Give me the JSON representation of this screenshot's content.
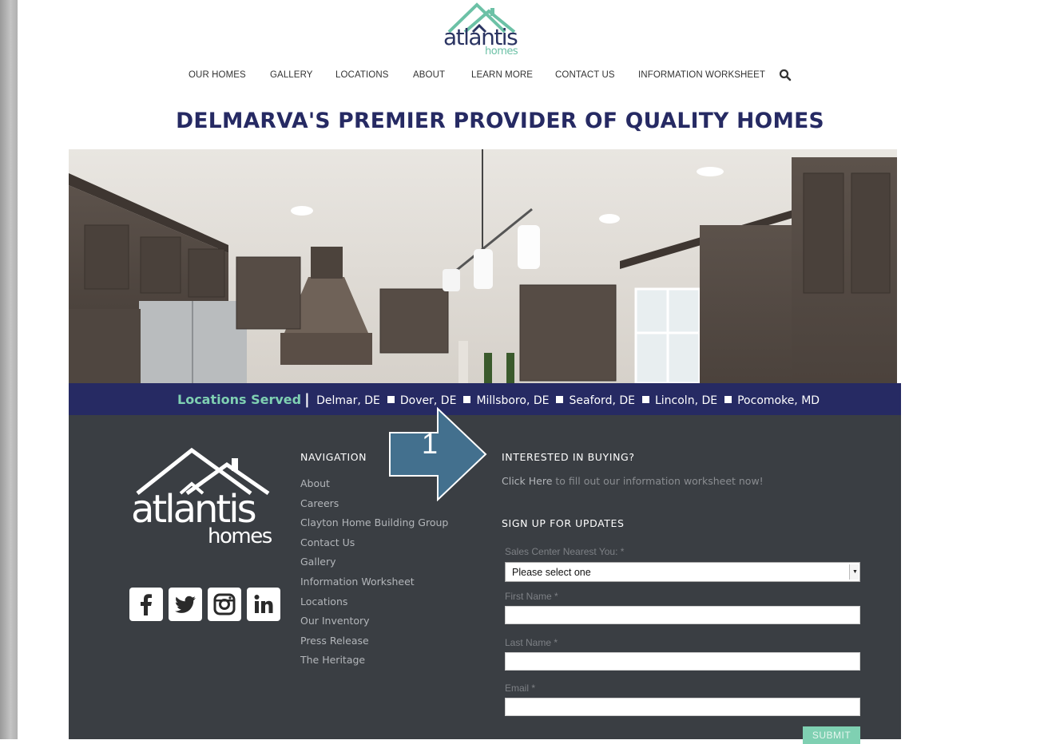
{
  "site": {
    "logo_word": "atlantis",
    "logo_sub": "homes"
  },
  "nav": {
    "items": [
      {
        "label": "OUR HOMES"
      },
      {
        "label": "GALLERY"
      },
      {
        "label": "LOCATIONS"
      },
      {
        "label": "ABOUT"
      },
      {
        "label": "LEARN MORE"
      },
      {
        "label": "CONTACT US"
      },
      {
        "label": "INFORMATION WORKSHEET"
      }
    ],
    "search_icon": "search-icon"
  },
  "headline": "DELMARVA'S PREMIER PROVIDER OF QUALITY HOMES",
  "hero": {
    "description_icon": "kitchen-photo"
  },
  "locations": {
    "label": "Locations Served",
    "separator": "|",
    "places": [
      "Delmar, DE",
      "Dover, DE",
      "Millsboro, DE",
      "Seaford, DE",
      "Lincoln, DE",
      "Pocomoke, MD"
    ]
  },
  "footer": {
    "logo_word": "atlantis",
    "logo_sub": "homes",
    "social": [
      {
        "name": "facebook-icon"
      },
      {
        "name": "twitter-icon"
      },
      {
        "name": "instagram-icon"
      },
      {
        "name": "linkedin-icon"
      }
    ],
    "nav_title": "NAVIGATION",
    "nav_links": [
      "About",
      "Careers",
      "Clayton Home Building Group",
      "Contact Us",
      "Gallery",
      "Information Worksheet",
      "Locations",
      "Our Inventory",
      "Press Release",
      "The Heritage"
    ],
    "annotation_number": "1",
    "buy_title": "INTERESTED IN BUYING?",
    "buy_click": "Click Here",
    "buy_rest": " to fill out our information worksheet now!",
    "signup_title": "SIGN UP FOR UPDATES",
    "form": {
      "sales_center_label": "Sales Center Nearest You: *",
      "sales_center_value": "Please select one",
      "first_name_label": "First Name *",
      "last_name_label": "Last Name *",
      "email_label": "Email *",
      "submit_label": "SUBMIT"
    }
  },
  "colors": {
    "navy": "#262a63",
    "mint": "#7fd0b2",
    "footer_bg": "#3a3e43",
    "arrow": "#43708e"
  }
}
